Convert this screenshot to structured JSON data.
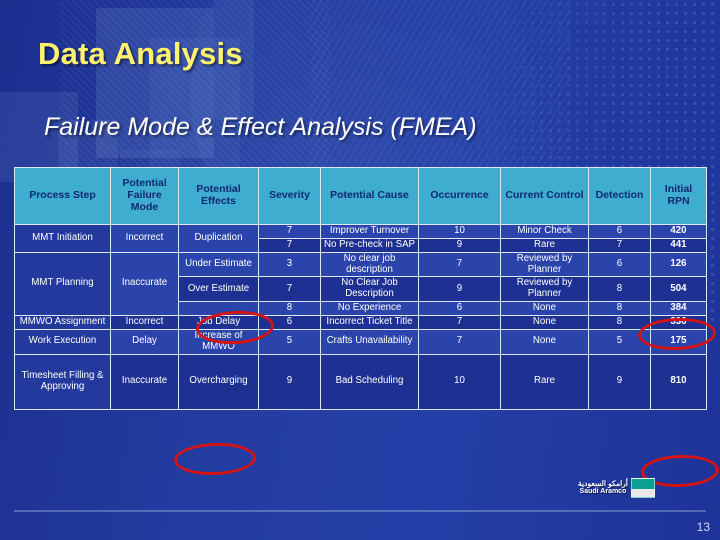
{
  "slide": {
    "title": "Data Analysis",
    "subtitle": "Failure Mode & Effect Analysis (FMEA)",
    "number": "13",
    "accent_yellow": "#FFF36E",
    "header_teal": "#3FADCF",
    "background_blue": "#233CA0",
    "annotation_red": "#D41414"
  },
  "logo": {
    "arabic": "أرامكو السعودية",
    "english": "Saudi Aramco"
  },
  "table": {
    "headers": [
      "Process Step",
      "Potential Failure Mode",
      "Potential Effects",
      "Severity",
      "Potential Cause",
      "Occurrence",
      "Current Control",
      "Detection",
      "Initial RPN"
    ],
    "rows": [
      {
        "process_step": "MMT Initiation",
        "failure_mode": "Incorrect",
        "effects": "Duplication",
        "severity": "7",
        "cause": "Improver Turnover",
        "occurrence": "10",
        "control": "Minor Check",
        "detection": "6",
        "rpn": "420"
      },
      {
        "process_step": "",
        "failure_mode": "",
        "effects": "",
        "severity": "7",
        "cause": "No Pre-check in SAP",
        "occurrence": "9",
        "control": "Rare",
        "detection": "7",
        "rpn": "441"
      },
      {
        "process_step": "MMT Planning",
        "failure_mode": "Inaccurate",
        "effects": "Under Estimate",
        "severity": "3",
        "cause": "No clear job description",
        "occurrence": "7",
        "control": "Reviewed by Planner",
        "detection": "6",
        "rpn": "126"
      },
      {
        "process_step": "",
        "failure_mode": "",
        "effects": "Over Estimate",
        "severity": "7",
        "cause": "No Clear Job Description",
        "occurrence": "9",
        "control": "Reviewed by Planner",
        "detection": "8",
        "rpn": "504"
      },
      {
        "process_step": "",
        "failure_mode": "",
        "effects": "",
        "severity": "8",
        "cause": "No Experience",
        "occurrence": "6",
        "control": "None",
        "detection": "8",
        "rpn": "384"
      },
      {
        "process_step": "MMWO Assignment",
        "failure_mode": "Incorrect",
        "effects": "Job Delay",
        "severity": "6",
        "cause": "Incorrect Ticket Title",
        "occurrence": "7",
        "control": "None",
        "detection": "8",
        "rpn": "336"
      },
      {
        "process_step": "Work Execution",
        "failure_mode": "Delay",
        "effects": "Increase of MMWO",
        "severity": "5",
        "cause": "Crafts Unavailability",
        "occurrence": "7",
        "control": "None",
        "detection": "5",
        "rpn": "175"
      },
      {
        "process_step": "Timesheet Filling & Approving",
        "failure_mode": "Inaccurate",
        "effects": "Overcharging",
        "severity": "9",
        "cause": "Bad Scheduling",
        "occurrence": "10",
        "control": "Rare",
        "detection": "9",
        "rpn": "810"
      }
    ],
    "highlights": [
      {
        "target": "effects-over-estimate",
        "shape": "ellipse"
      },
      {
        "target": "rpn-504",
        "shape": "ellipse"
      },
      {
        "target": "effects-overcharging",
        "shape": "ellipse"
      },
      {
        "target": "rpn-810",
        "shape": "ellipse"
      }
    ]
  }
}
